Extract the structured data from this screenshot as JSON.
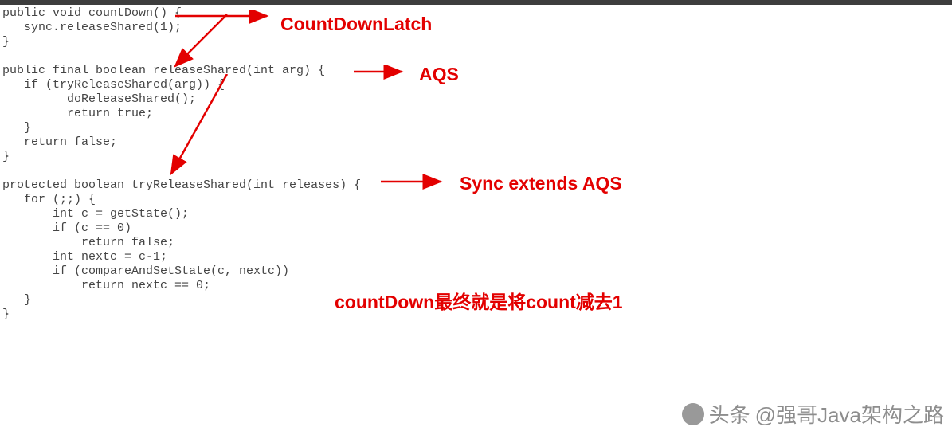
{
  "code": "public void countDown() {\n   sync.releaseShared(1);\n}\n\npublic final boolean releaseShared(int arg) {\n   if (tryReleaseShared(arg)) {\n         doReleaseShared();\n         return true;\n   }\n   return false;\n}\n\nprotected boolean tryReleaseShared(int releases) {\n   for (;;) {\n       int c = getState();\n       if (c == 0)\n           return false;\n       int nextc = c-1;\n       if (compareAndSetState(c, nextc))\n           return nextc == 0;\n   }\n}",
  "annotations": {
    "label1": "CountDownLatch",
    "label2": "AQS",
    "label3": "Sync  extends AQS",
    "comment": "countDown最终就是将count减去1"
  },
  "watermark": {
    "prefix": "头条",
    "handle": "@强哥Java架构之路"
  }
}
